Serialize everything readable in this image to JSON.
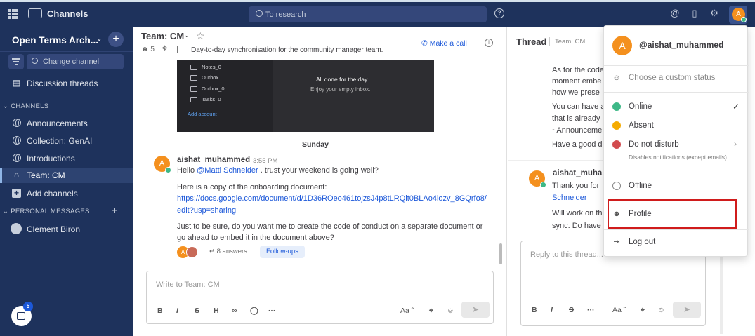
{
  "topbar": {
    "channels_label": "Channels",
    "search_placeholder": "To research",
    "avatar_letter": "A"
  },
  "sidebar": {
    "team_name": "Open Terms Arch...",
    "change_channel": "Change channel",
    "threads": "Discussion threads",
    "channels_header": "CHANNELS",
    "channels": [
      "Announcements",
      "Collection: GenAI",
      "Introductions",
      "Team: CM",
      "Add channels"
    ],
    "pm_header": "PERSONAL MESSAGES",
    "pm_user": "Clement Biron",
    "notif_count": "5"
  },
  "channel": {
    "title": "Team: CM",
    "members": "5",
    "purpose": "Day-to-day synchronisation for the community manager team.",
    "make_call": "Make a call",
    "email_image": {
      "folders": [
        "Notes_0",
        "Outbox",
        "Outbox_0",
        "Tasks_0"
      ],
      "add_account": "Add account",
      "done_title": "All done for the day",
      "done_sub": "Enjoy your empty inbox."
    },
    "date_sep": "Sunday",
    "post": {
      "avatar": "A",
      "username": "aishat_muhammed",
      "time": "3:55 PM",
      "line1_pre": "Hello ",
      "line1_mention": "@Matti Schneider",
      "line1_post": " . trust your weekend is going well?",
      "line2": "Here is a copy of the onboarding document:",
      "link1": "https://docs.google.com/document/d/1D36ROeo461tojzsJ4p8tLRQit0BLAo4lozv_8GQrfo8/",
      "link2": "edit?usp=sharing",
      "line3": "Just to be sure, do you want me to create the code of conduct on a separate document or",
      "line4": "go ahead to embed it in the document above?",
      "answers": "8 answers",
      "followups": "Follow-ups"
    },
    "editor_placeholder": "Write to Team: CM",
    "format_icons": [
      "B",
      "I",
      "S",
      "H",
      "link",
      "emoji-clock",
      "..."
    ],
    "aa": "Aa"
  },
  "thread": {
    "title": "Thread",
    "subtitle": "Team: CM",
    "lines": [
      "As for the code",
      "moment embe",
      "how we prese",
      "You can have a",
      "that is already",
      "~Announceme",
      "Have a good da"
    ],
    "reply_user": "aishat_muhammed",
    "reply_avatar": "A",
    "reply_lines": [
      "Thank you for",
      "Schneider",
      "Will work on th",
      "sync. Do have a"
    ],
    "reply_placeholder": "Reply to this thread...",
    "aa": "Aa"
  },
  "status_menu": {
    "username": "@aishat_muhammed",
    "avatar": "A",
    "custom_status": "Choose a custom status",
    "online": "Online",
    "absent": "Absent",
    "dnd": "Do not disturb",
    "dnd_sub": "Disables notifications (except emails)",
    "offline": "Offline",
    "profile": "Profile",
    "logout": "Log out",
    "colors": {
      "online": "#3db887",
      "absent": "#f5ab00",
      "dnd": "#d24b4e",
      "highlight": "#d01c1c"
    }
  }
}
